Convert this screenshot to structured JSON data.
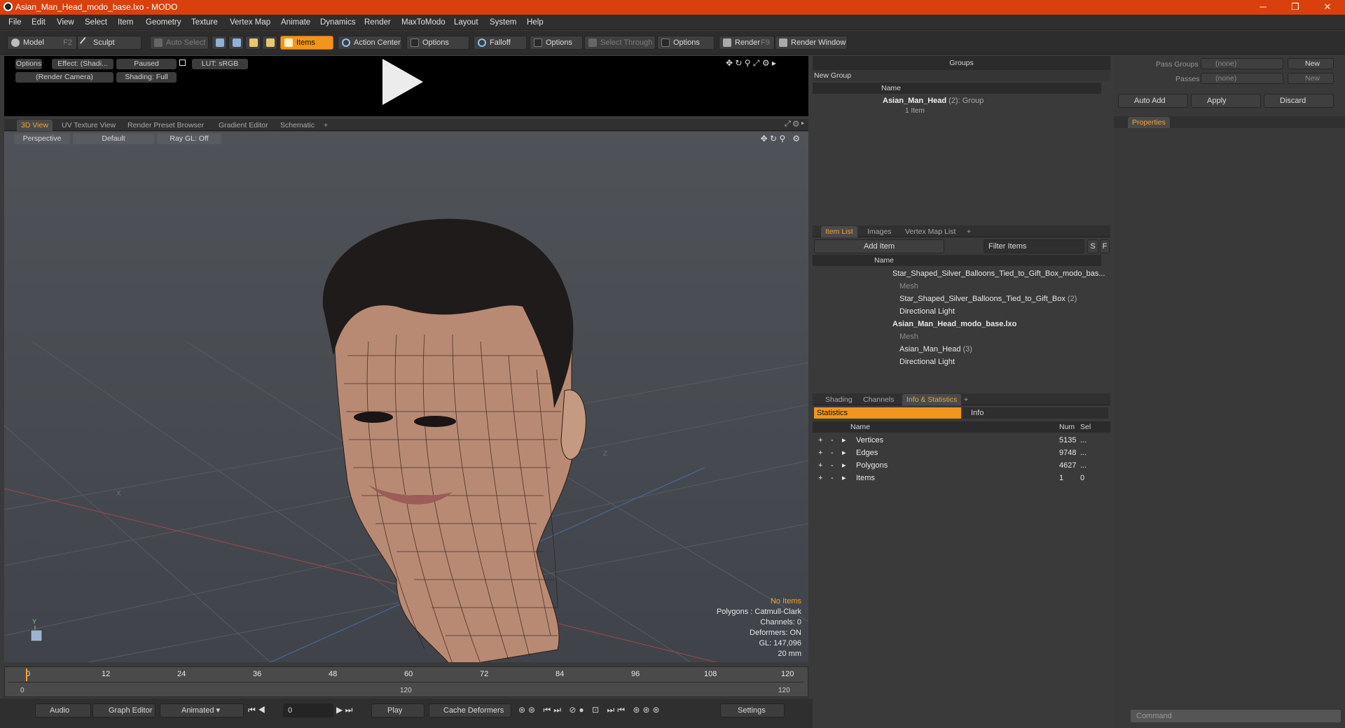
{
  "window": {
    "title": "Asian_Man_Head_modo_base.lxo - MODO",
    "minimize": "─",
    "maximize": "❐",
    "close": "✕"
  },
  "menu": [
    "File",
    "Edit",
    "View",
    "Select",
    "Item",
    "Geometry",
    "Texture",
    "Vertex Map",
    "Animate",
    "Dynamics",
    "Render",
    "MaxToModo",
    "Layout",
    "System",
    "Help"
  ],
  "toolbar": {
    "model": "Model",
    "model_key": "F2",
    "sculpt": "Sculpt",
    "auto_select": "Auto Select",
    "items": "Items",
    "action_center": "Action Center",
    "options1": "Options",
    "falloff": "Falloff",
    "options2": "Options",
    "select_through": "Select Through",
    "options3": "Options",
    "render": "Render",
    "render_key": "F9",
    "render_window": "Render Window"
  },
  "preview": {
    "options": "Options",
    "effect": "Effect: (Shadi...",
    "paused": "Paused",
    "lut": "LUT: sRGB",
    "camera": "(Render Camera)",
    "shading": "Shading: Full"
  },
  "view_tabs": [
    "3D View",
    "UV Texture View",
    "Render Preset Browser",
    "Gradient Editor",
    "Schematic",
    "+"
  ],
  "viewport": {
    "perspective": "Perspective",
    "default": "Default",
    "raygl": "Ray GL: Off",
    "axis_x": "X",
    "axis_z": "Z",
    "axis_y": "Y",
    "stats": {
      "no_items": "No Items",
      "polygons": "Polygons : Catmull-Clark",
      "channels": "Channels: 0",
      "deformers": "Deformers: ON",
      "gl": "GL: 147,096",
      "size": "20 mm"
    }
  },
  "timeline": {
    "ticks": [
      "0",
      "12",
      "24",
      "36",
      "48",
      "60",
      "72",
      "84",
      "96",
      "108",
      "120"
    ],
    "start": "0",
    "mid": "120",
    "end": "120"
  },
  "transport": {
    "audio": "Audio",
    "graph_editor": "Graph Editor",
    "animated": "Animated",
    "frame": "0",
    "play": "Play",
    "cache_deformers": "Cache Deformers",
    "settings": "Settings"
  },
  "groups": {
    "title": "Groups",
    "new_group": "New Group",
    "col_name": "Name",
    "item_name": "Asian_Man_Head",
    "item_count": "(2)",
    "item_type": ": Group",
    "item_sub": "1 Item"
  },
  "itemlist": {
    "tabs": [
      "Item List",
      "Images",
      "Vertex Map List",
      "+"
    ],
    "add_item": "Add Item",
    "filter": "Filter Items",
    "s": "S",
    "f": "F",
    "col_name": "Name",
    "rows": [
      {
        "label": "Star_Shaped_Silver_Balloons_Tied_to_Gift_Box_modo_bas...",
        "extra": "",
        "indent": 0,
        "bold": false,
        "grey": false
      },
      {
        "label": "Mesh",
        "extra": "",
        "indent": 2,
        "bold": false,
        "grey": true
      },
      {
        "label": "Star_Shaped_Silver_Balloons_Tied_to_Gift_Box",
        "extra": "(2)",
        "indent": 2,
        "bold": false,
        "grey": false
      },
      {
        "label": "Directional Light",
        "extra": "",
        "indent": 2,
        "bold": false,
        "grey": false
      },
      {
        "label": "Asian_Man_Head_modo_base.lxo",
        "extra": "",
        "indent": 0,
        "bold": true,
        "grey": false
      },
      {
        "label": "Mesh",
        "extra": "",
        "indent": 2,
        "bold": false,
        "grey": true
      },
      {
        "label": "Asian_Man_Head",
        "extra": "(3)",
        "indent": 2,
        "bold": false,
        "grey": false
      },
      {
        "label": "Directional Light",
        "extra": "",
        "indent": 2,
        "bold": false,
        "grey": false
      }
    ]
  },
  "stats_panel": {
    "tabs": [
      "Shading",
      "Channels",
      "Info & Statistics",
      "+"
    ],
    "statistics": "Statistics",
    "info": "Info",
    "col_name": "Name",
    "col_num": "Num",
    "col_sel": "Sel",
    "rows": [
      {
        "name": "Vertices",
        "num": "5135",
        "sel": "..."
      },
      {
        "name": "Edges",
        "num": "9748",
        "sel": "..."
      },
      {
        "name": "Polygons",
        "num": "4627",
        "sel": "..."
      },
      {
        "name": "Items",
        "num": "1",
        "sel": "0"
      }
    ]
  },
  "right": {
    "pass_groups": "Pass Groups",
    "passes": "Passes",
    "none": "(none)",
    "new": "New",
    "auto_add": "Auto Add",
    "apply": "Apply",
    "discard": "Discard",
    "properties": "Properties",
    "command": "Command"
  }
}
